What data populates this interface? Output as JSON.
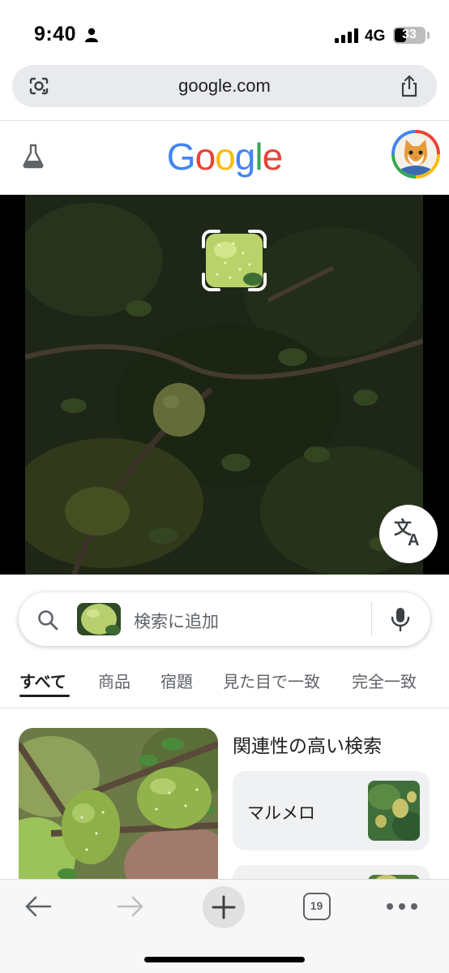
{
  "status_bar": {
    "time": "9:40",
    "network": "4G",
    "battery": "33"
  },
  "browser": {
    "url": "google.com"
  },
  "google": {
    "logo_letters": [
      "G",
      "o",
      "o",
      "g",
      "l",
      "e"
    ],
    "logo_colors": [
      "#4285f4",
      "#ea4335",
      "#fbbc05",
      "#4285f4",
      "#34a853",
      "#ea4335"
    ]
  },
  "search": {
    "placeholder": "検索に追加"
  },
  "tabs": [
    {
      "label": "すべて",
      "active": true
    },
    {
      "label": "商品",
      "active": false
    },
    {
      "label": "宿題",
      "active": false
    },
    {
      "label": "見た目で一致",
      "active": false
    },
    {
      "label": "完全一致",
      "active": false
    }
  ],
  "related": {
    "title": "関連性の高い検索",
    "items": [
      {
        "label": "マルメロ"
      }
    ]
  },
  "toolbar": {
    "tab_count": "19"
  },
  "colors": {
    "accent": "#1f1f1f",
    "muted": "#5f6368",
    "pill_bg": "#e8eaed"
  }
}
